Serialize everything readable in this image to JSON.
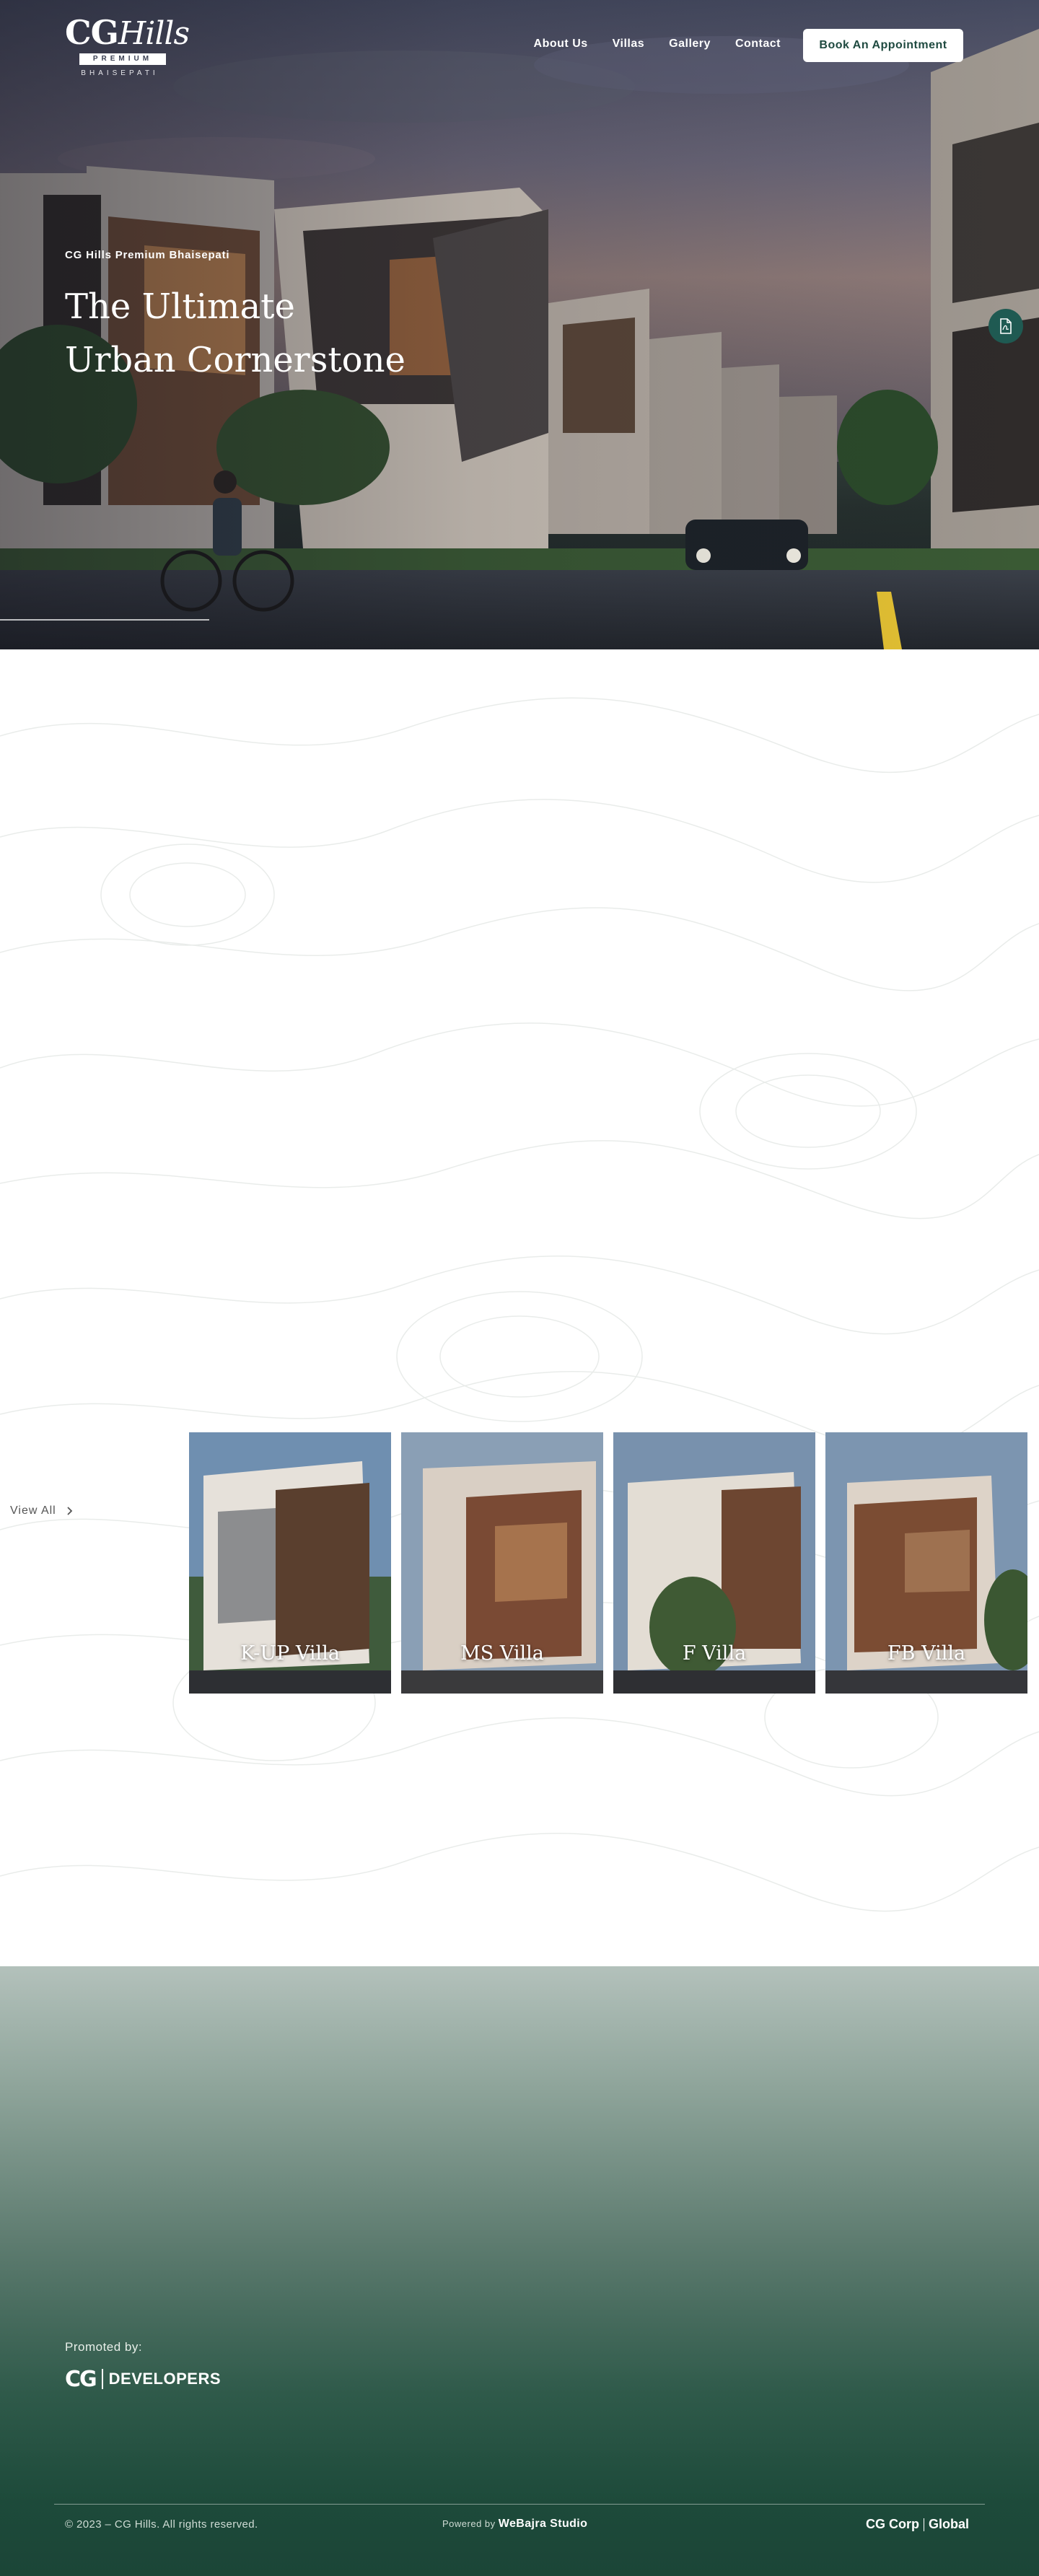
{
  "header": {
    "logo": {
      "brand": "CG",
      "script": "Hills",
      "tier": "PREMIUM",
      "place": "BHAISEPATI"
    },
    "nav": [
      {
        "label": "About Us"
      },
      {
        "label": "Villas"
      },
      {
        "label": "Gallery"
      },
      {
        "label": "Contact"
      }
    ],
    "cta_label": "Book An Appointment"
  },
  "hero": {
    "eyebrow": "CG Hills Premium Bhaisepati",
    "headline_line1": "The Ultimate",
    "headline_line2": "Urban Cornerstone",
    "pdf_icon": "pdf-file-icon"
  },
  "villas": {
    "view_all_label": "View All",
    "view_all_icon": "chevron-right-icon",
    "cards": [
      {
        "name": "K-UP Villa"
      },
      {
        "name": "MS Villa"
      },
      {
        "name": "F Villa"
      },
      {
        "name": "FB Villa"
      }
    ]
  },
  "footer": {
    "promoted_label": "Promoted by:",
    "promoter_logo": {
      "mark": "CG",
      "text": "DEVELOPERS"
    },
    "copyright": "© 2023 – CG Hills. All rights reserved.",
    "powered_prefix": "Powered by",
    "powered_by": "WeBajra Studio",
    "corp_logo": {
      "left": "CG Corp",
      "right": "Global"
    }
  },
  "colors": {
    "brand_green": "#1f5a52",
    "footer_dark": "#1b4537",
    "cta_text": "#1f4a40"
  }
}
